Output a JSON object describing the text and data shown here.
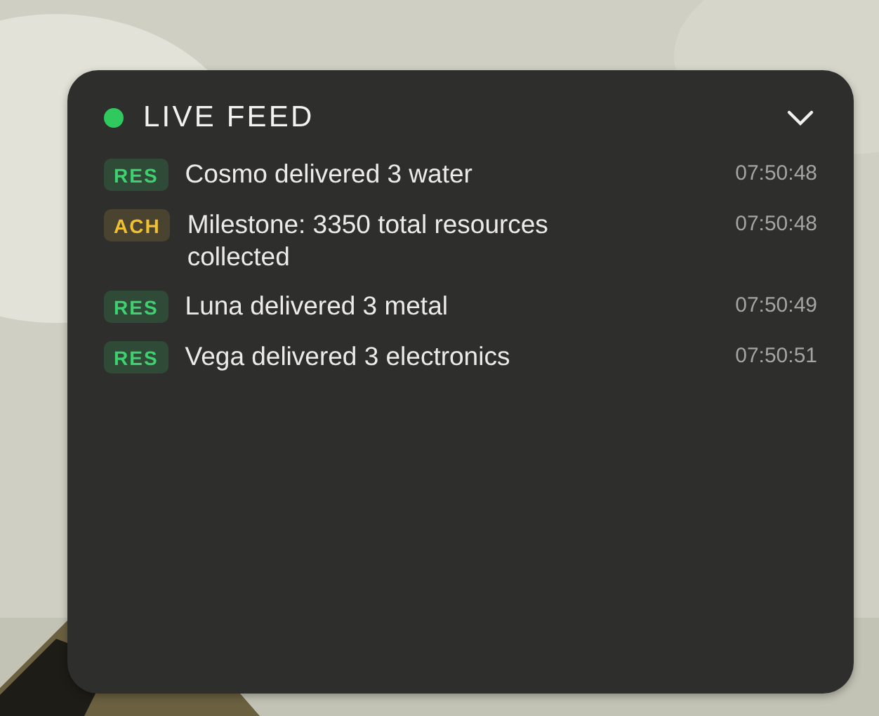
{
  "feed": {
    "title": "LIVE FEED",
    "live": true,
    "expanded": true,
    "events": [
      {
        "kind": "res",
        "tag": "RES",
        "message": "Cosmo delivered 3 water",
        "time": "07:50:48"
      },
      {
        "kind": "ach",
        "tag": "ACH",
        "message": "Milestone: 3350 total resources collected",
        "time": "07:50:48"
      },
      {
        "kind": "res",
        "tag": "RES",
        "message": "Luna delivered 3 metal",
        "time": "07:50:49"
      },
      {
        "kind": "res",
        "tag": "RES",
        "message": "Vega delivered 3 electronics",
        "time": "07:50:51"
      }
    ]
  }
}
